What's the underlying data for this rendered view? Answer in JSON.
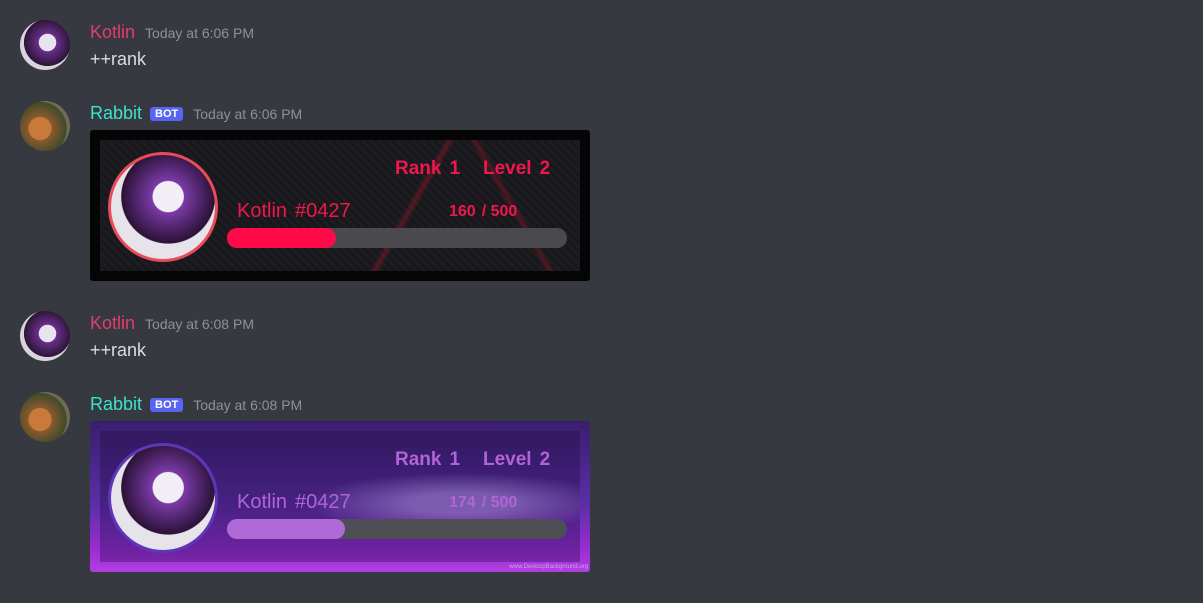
{
  "messages": [
    {
      "author": "Kotlin",
      "timestamp": "Today at 6:06 PM",
      "text": "++rank"
    },
    {
      "author": "Rabbit",
      "bot_tag": "BOT",
      "timestamp": "Today at 6:06 PM",
      "card": {
        "rank_label": "Rank",
        "rank": "1",
        "level_label": "Level",
        "level": "2",
        "username": "Kotlin",
        "discriminator": "#0427",
        "xp": "160",
        "xp_max": "/ 500",
        "progress": 0.32,
        "theme_color": "#ff0a48"
      }
    },
    {
      "author": "Kotlin",
      "timestamp": "Today at 6:08 PM",
      "text": "++rank"
    },
    {
      "author": "Rabbit",
      "bot_tag": "BOT",
      "timestamp": "Today at 6:08 PM",
      "card": {
        "rank_label": "Rank",
        "rank": "1",
        "level_label": "Level",
        "level": "2",
        "username": "Kotlin",
        "discriminator": "#0427",
        "xp": "174",
        "xp_max": "/ 500",
        "progress": 0.348,
        "theme_color": "#b06ad8",
        "watermark": "www.DesktopBackground.org"
      }
    }
  ],
  "colors": {
    "background": "#36393f",
    "kotlin_name": "#e63b6f",
    "rabbit_name": "#3ae3cf",
    "bot_tag": "#5865f2",
    "timestamp": "#8e9297"
  }
}
